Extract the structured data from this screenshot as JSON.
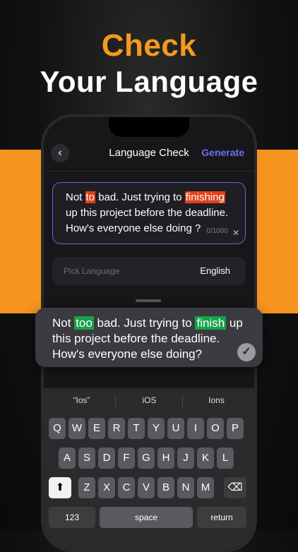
{
  "headline": {
    "line1": "Check",
    "line2": "Your Language"
  },
  "nav": {
    "back_glyph": "‹",
    "title": "Language Check",
    "action": "Generate"
  },
  "input": {
    "segments": [
      {
        "text": "Not ",
        "mark": false
      },
      {
        "text": "to",
        "mark": true
      },
      {
        "text": " bad. Just trying to ",
        "mark": false
      },
      {
        "text": "finishing",
        "mark": true
      },
      {
        "text": " up this project before the deadline. How's everyone else doing ?",
        "mark": false
      }
    ],
    "counter": "0/1000",
    "clear": "✕"
  },
  "language": {
    "label": "Pick Language",
    "value": "English"
  },
  "keyboard": {
    "suggestions": [
      "“Ios”",
      "iOS",
      "Ions"
    ],
    "row1": [
      "Q",
      "W",
      "E",
      "R",
      "T",
      "Y",
      "U",
      "I",
      "O",
      "P"
    ],
    "row2": [
      "A",
      "S",
      "D",
      "F",
      "G",
      "H",
      "J",
      "K",
      "L"
    ],
    "row3": [
      "Z",
      "X",
      "C",
      "V",
      "B",
      "N",
      "M"
    ],
    "shift": "⬆",
    "backspace": "⌫",
    "numbers": "123",
    "space": "space",
    "return": "return"
  },
  "correction": {
    "segments": [
      {
        "text": "Not ",
        "mark": false
      },
      {
        "text": "too",
        "mark": true
      },
      {
        "text": " bad. Just trying to ",
        "mark": false
      },
      {
        "text": "finish",
        "mark": true
      },
      {
        "text": " up this project before the deadline. How's everyone else doing?",
        "mark": false
      }
    ],
    "check": "✓"
  },
  "colors": {
    "accent": "#f59a1d",
    "link": "#6e6ff0",
    "error": "#e0401a",
    "fix": "#16a34a"
  }
}
